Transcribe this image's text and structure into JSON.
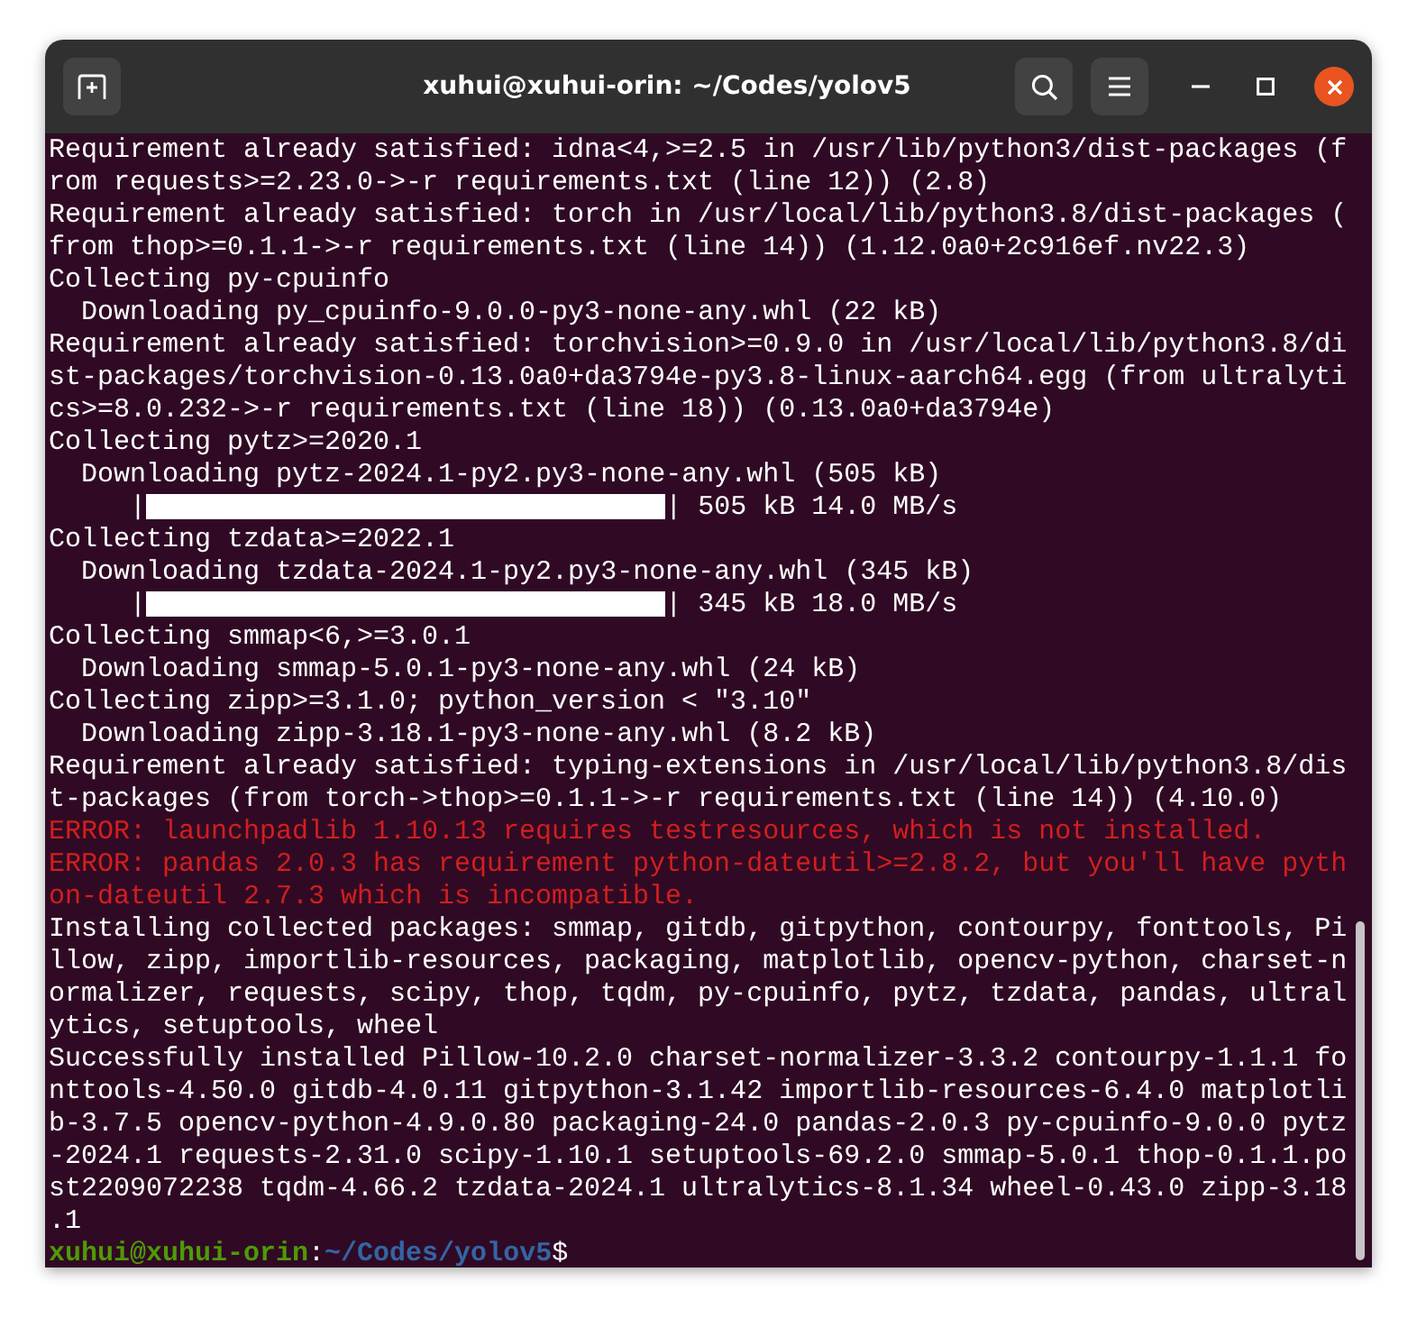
{
  "window": {
    "title": "xuhui@xuhui-orin: ~/Codes/yolov5"
  },
  "lines": [
    {
      "kind": "output",
      "text": "Requirement already satisfied: idna<4,>=2.5 in /usr/lib/python3/dist-packages (from requests>=2.23.0->-r requirements.txt (line 12)) (2.8)"
    },
    {
      "kind": "output",
      "text": "Requirement already satisfied: torch in /usr/local/lib/python3.8/dist-packages (from thop>=0.1.1->-r requirements.txt (line 14)) (1.12.0a0+2c916ef.nv22.3)"
    },
    {
      "kind": "output",
      "text": "Collecting py-cpuinfo"
    },
    {
      "kind": "output",
      "text": "  Downloading py_cpuinfo-9.0.0-py3-none-any.whl (22 kB)"
    },
    {
      "kind": "output",
      "text": "Requirement already satisfied: torchvision>=0.9.0 in /usr/local/lib/python3.8/dist-packages/torchvision-0.13.0a0+da3794e-py3.8-linux-aarch64.egg (from ultralytics>=8.0.232->-r requirements.txt (line 18)) (0.13.0a0+da3794e)"
    },
    {
      "kind": "output",
      "text": "Collecting pytz>=2020.1"
    },
    {
      "kind": "output",
      "text": "  Downloading pytz-2024.1-py2.py3-none-any.whl (505 kB)"
    },
    {
      "kind": "progress",
      "prefix": "     |",
      "level": 1,
      "suffix": "| 505 kB 14.0 MB/s"
    },
    {
      "kind": "output",
      "text": "Collecting tzdata>=2022.1"
    },
    {
      "kind": "output",
      "text": "  Downloading tzdata-2024.1-py2.py3-none-any.whl (345 kB)"
    },
    {
      "kind": "progress",
      "prefix": "     |",
      "level": 1,
      "suffix": "| 345 kB 18.0 MB/s"
    },
    {
      "kind": "output",
      "text": "Collecting smmap<6,>=3.0.1"
    },
    {
      "kind": "output",
      "text": "  Downloading smmap-5.0.1-py3-none-any.whl (24 kB)"
    },
    {
      "kind": "output",
      "text": "Collecting zipp>=3.1.0; python_version < \"3.10\""
    },
    {
      "kind": "output",
      "text": "  Downloading zipp-3.18.1-py3-none-any.whl (8.2 kB)"
    },
    {
      "kind": "output",
      "text": "Requirement already satisfied: typing-extensions in /usr/local/lib/python3.8/dist-packages (from torch->thop>=0.1.1->-r requirements.txt (line 14)) (4.10.0)"
    },
    {
      "kind": "error",
      "text": "ERROR: launchpadlib 1.10.13 requires testresources, which is not installed."
    },
    {
      "kind": "error",
      "text": "ERROR: pandas 2.0.3 has requirement python-dateutil>=2.8.2, but you'll have python-dateutil 2.7.3 which is incompatible."
    },
    {
      "kind": "output",
      "text": "Installing collected packages: smmap, gitdb, gitpython, contourpy, fonttools, Pillow, zipp, importlib-resources, packaging, matplotlib, opencv-python, charset-normalizer, requests, scipy, thop, tqdm, py-cpuinfo, pytz, tzdata, pandas, ultralytics, setuptools, wheel"
    },
    {
      "kind": "output",
      "text": "Successfully installed Pillow-10.2.0 charset-normalizer-3.3.2 contourpy-1.1.1 fonttools-4.50.0 gitdb-4.0.11 gitpython-3.1.42 importlib-resources-6.4.0 matplotlib-3.7.5 opencv-python-4.9.0.80 packaging-24.0 pandas-2.0.3 py-cpuinfo-9.0.0 pytz-2024.1 requests-2.31.0 scipy-1.10.1 setuptools-69.2.0 smmap-5.0.1 thop-0.1.1.post2209072238 tqdm-4.66.2 tzdata-2024.1 ultralytics-8.1.34 wheel-0.43.0 zipp-3.18.1"
    },
    {
      "kind": "prompt",
      "user_host": "xuhui@xuhui-orin",
      "separator": ":",
      "path": "~/Codes/yolov5",
      "symbol": "$"
    }
  ]
}
